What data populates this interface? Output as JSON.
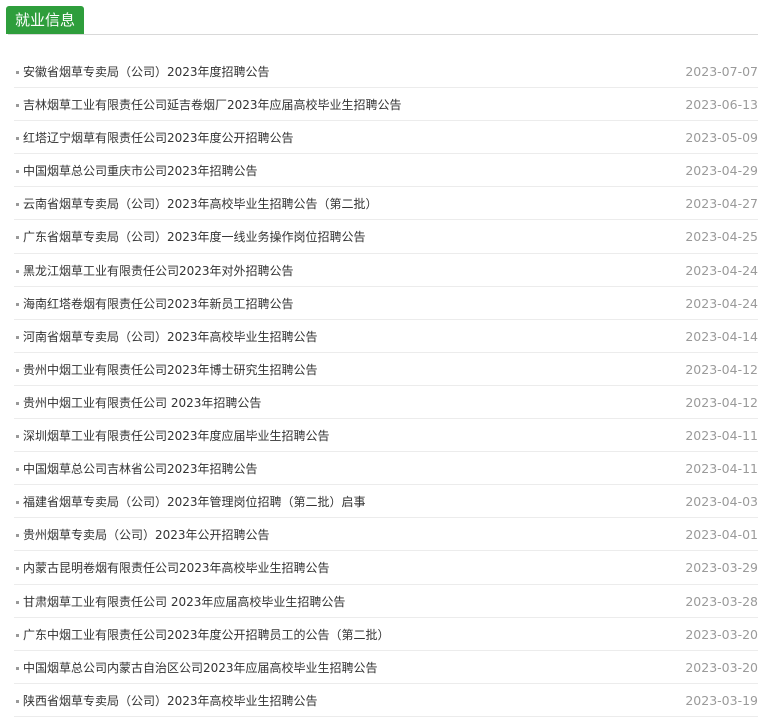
{
  "header": {
    "tab_label": "就业信息"
  },
  "items": [
    {
      "title": "安徽省烟草专卖局（公司）2023年度招聘公告",
      "date": "2023-07-07"
    },
    {
      "title": "吉林烟草工业有限责任公司延吉卷烟厂2023年应届高校毕业生招聘公告",
      "date": "2023-06-13"
    },
    {
      "title": "红塔辽宁烟草有限责任公司2023年度公开招聘公告",
      "date": "2023-05-09"
    },
    {
      "title": "中国烟草总公司重庆市公司2023年招聘公告",
      "date": "2023-04-29"
    },
    {
      "title": "云南省烟草专卖局（公司）2023年高校毕业生招聘公告（第二批）",
      "date": "2023-04-27"
    },
    {
      "title": "广东省烟草专卖局（公司）2023年度一线业务操作岗位招聘公告",
      "date": "2023-04-25"
    },
    {
      "title": "黑龙江烟草工业有限责任公司2023年对外招聘公告",
      "date": "2023-04-24"
    },
    {
      "title": "海南红塔卷烟有限责任公司2023年新员工招聘公告",
      "date": "2023-04-24"
    },
    {
      "title": "河南省烟草专卖局（公司）2023年高校毕业生招聘公告",
      "date": "2023-04-14"
    },
    {
      "title": "贵州中烟工业有限责任公司2023年博士研究生招聘公告",
      "date": "2023-04-12"
    },
    {
      "title": "贵州中烟工业有限责任公司 2023年招聘公告",
      "date": "2023-04-12"
    },
    {
      "title": "深圳烟草工业有限责任公司2023年度应届毕业生招聘公告",
      "date": "2023-04-11"
    },
    {
      "title": "中国烟草总公司吉林省公司2023年招聘公告",
      "date": "2023-04-11"
    },
    {
      "title": "福建省烟草专卖局（公司）2023年管理岗位招聘（第二批）启事",
      "date": "2023-04-03"
    },
    {
      "title": "贵州烟草专卖局（公司）2023年公开招聘公告",
      "date": "2023-04-01"
    },
    {
      "title": "内蒙古昆明卷烟有限责任公司2023年高校毕业生招聘公告",
      "date": "2023-03-29"
    },
    {
      "title": "甘肃烟草工业有限责任公司 2023年应届高校毕业生招聘公告",
      "date": "2023-03-28"
    },
    {
      "title": "广东中烟工业有限责任公司2023年度公开招聘员工的公告（第二批）",
      "date": "2023-03-20"
    },
    {
      "title": "中国烟草总公司内蒙古自治区公司2023年应届高校毕业生招聘公告",
      "date": "2023-03-20"
    },
    {
      "title": "陕西省烟草专卖局（公司）2023年高校毕业生招聘公告",
      "date": "2023-03-19"
    }
  ]
}
